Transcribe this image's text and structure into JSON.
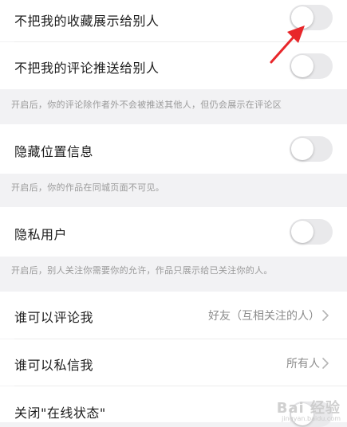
{
  "settings": {
    "hide_favorites": {
      "label": "不把我的收藏展示给别人",
      "enabled": false
    },
    "hide_comment_push": {
      "label": "不把我的评论推送给别人",
      "enabled": false,
      "description": "开启后，你的评论除作者外不会被推送其他人，但仍会展示在评论区"
    },
    "hide_location": {
      "label": "隐藏位置信息",
      "enabled": false,
      "description": "开启后，你的作品在同城页面不可见。"
    },
    "private_user": {
      "label": "隐私用户",
      "enabled": false,
      "description": "开启后，别人关注你需要你的允许，作品只展示给已关注你的人。"
    },
    "who_can_comment": {
      "label": "谁可以评论我",
      "value": "好友（互相关注的人）"
    },
    "who_can_message": {
      "label": "谁可以私信我",
      "value": "所有人"
    },
    "online_status": {
      "label": "关闭\"在线状态\"",
      "enabled": false
    }
  },
  "icons": {
    "chevron": "chevron-right-icon",
    "annotation_arrow": "red-arrow-icon"
  },
  "colors": {
    "background": "#f2f2f4",
    "toggle_off": "#e9e9eb",
    "arrow": "#e8262a",
    "description_text": "#9a9a9a"
  },
  "watermark": {
    "text": "Bai 经验",
    "sub": "jingyan.baidu.com"
  }
}
